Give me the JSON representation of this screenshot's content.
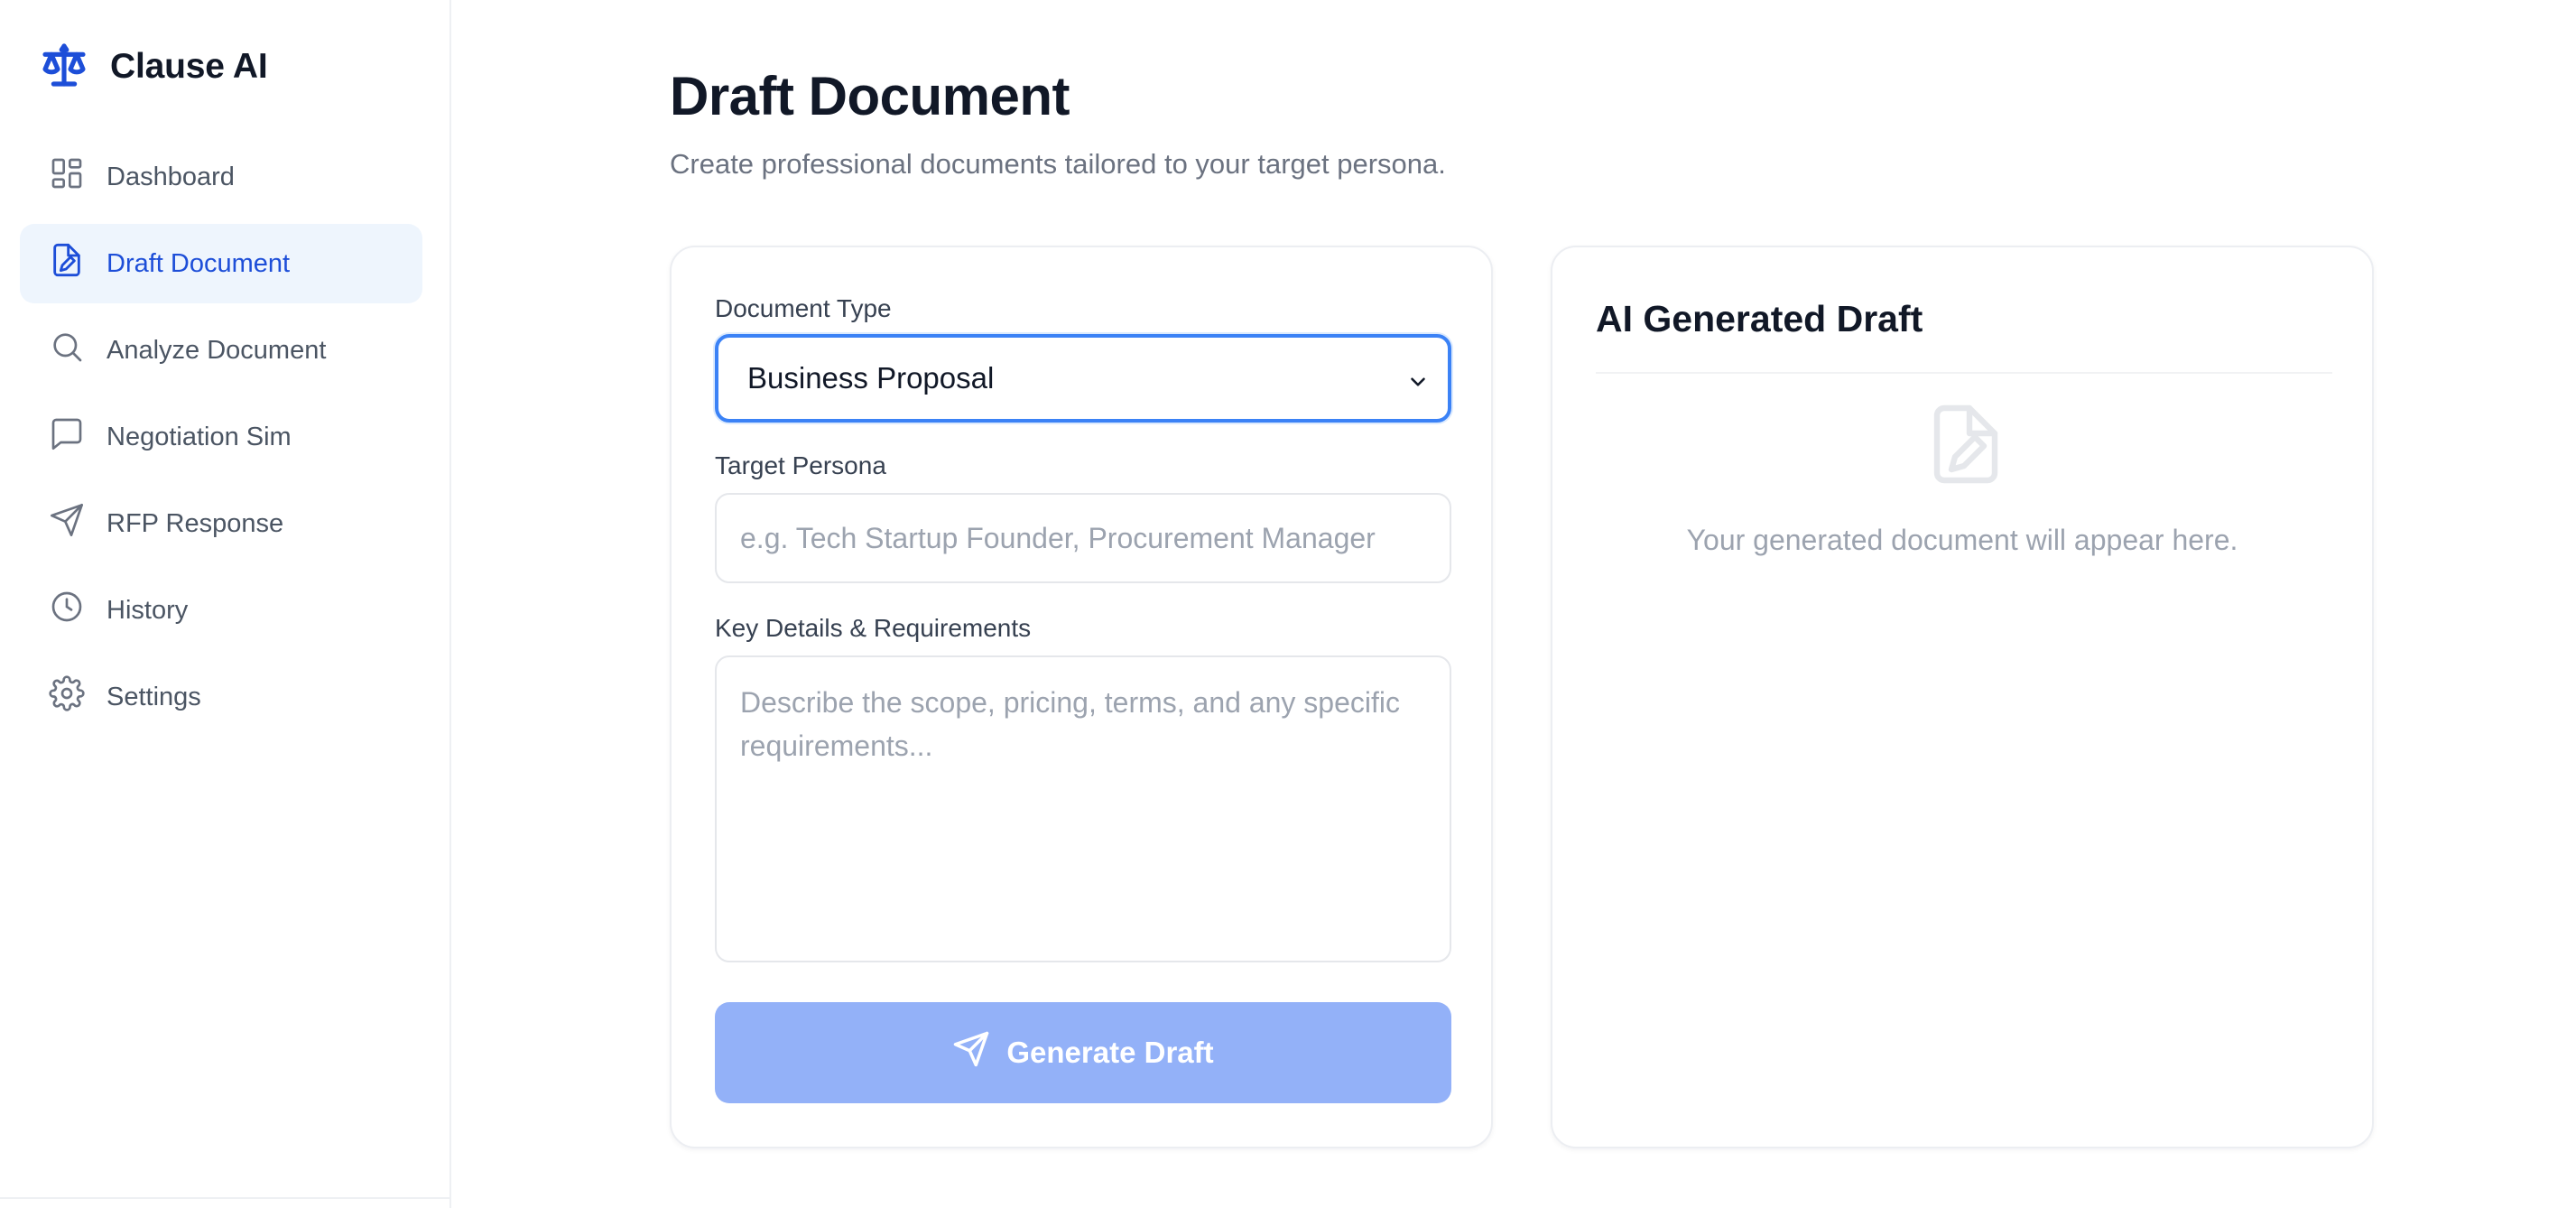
{
  "app": {
    "name": "Clause AI"
  },
  "sidebar": {
    "items": [
      {
        "label": "Dashboard",
        "icon": "dashboard-icon",
        "active": false
      },
      {
        "label": "Draft Document",
        "icon": "draft-file-icon",
        "active": true
      },
      {
        "label": "Analyze Document",
        "icon": "search-icon",
        "active": false
      },
      {
        "label": "Negotiation Sim",
        "icon": "message-icon",
        "active": false
      },
      {
        "label": "RFP Response",
        "icon": "send-icon",
        "active": false
      },
      {
        "label": "History",
        "icon": "clock-icon",
        "active": false
      },
      {
        "label": "Settings",
        "icon": "gear-icon",
        "active": false
      }
    ]
  },
  "page": {
    "title": "Draft Document",
    "subtitle": "Create professional documents tailored to your target persona."
  },
  "form": {
    "document_type_label": "Document Type",
    "document_type_value": "Business Proposal",
    "persona_label": "Target Persona",
    "persona_placeholder": "e.g. Tech Startup Founder, Procurement Manager",
    "details_label": "Key Details & Requirements",
    "details_placeholder": "Describe the scope, pricing, terms, and any specific requirements...",
    "generate_label": "Generate Draft"
  },
  "output": {
    "title": "AI Generated Draft",
    "placeholder": "Your generated document will appear here."
  },
  "colors": {
    "accent": "#1d4ed8",
    "accent_light": "#eef5fd",
    "button_disabled": "#93b1f8",
    "focus_border": "#3b82f6"
  }
}
